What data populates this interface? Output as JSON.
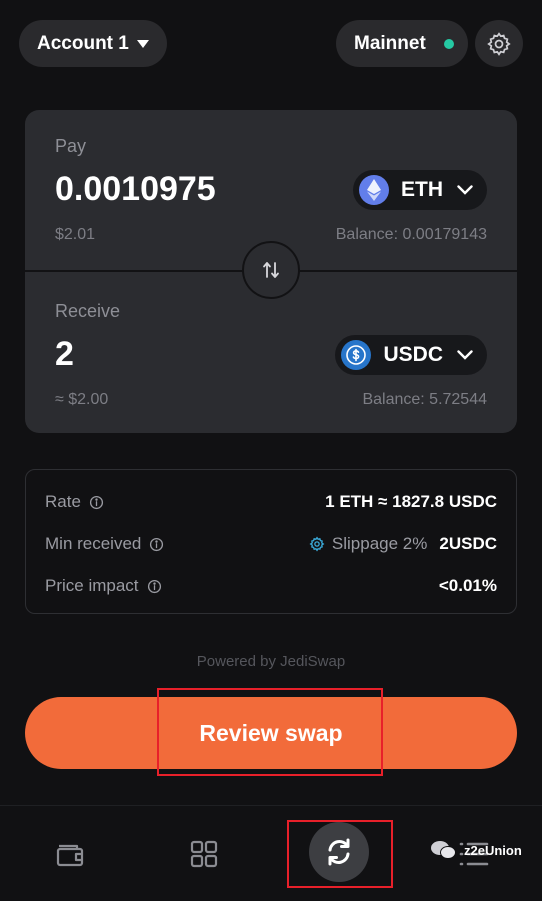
{
  "header": {
    "account_label": "Account 1",
    "network_label": "Mainnet",
    "network_status_color": "#25c9a3"
  },
  "swap": {
    "pay": {
      "label": "Pay",
      "amount": "0.0010975",
      "fiat": "$2.01",
      "token": "ETH",
      "balance": "Balance: 0.00179143"
    },
    "receive": {
      "label": "Receive",
      "amount": "2",
      "fiat": "≈ $2.00",
      "token": "USDC",
      "balance": "Balance: 5.72544"
    }
  },
  "details": {
    "rate_label": "Rate",
    "rate_value": "1 ETH ≈ 1827.8 USDC",
    "min_received_label": "Min received",
    "slippage_label": "Slippage 2%",
    "min_received_value": "2USDC",
    "price_impact_label": "Price impact",
    "price_impact_value": "<0.01%"
  },
  "powered_by": "Powered by JediSwap",
  "review_button_label": "Review swap",
  "colors": {
    "accent": "#f26b3a",
    "highlight": "#e8202a",
    "eth": "#627eea",
    "usdc": "#2775ca"
  },
  "nav": {
    "items": [
      "wallet-icon",
      "apps-grid-icon",
      "swap-icon",
      "activity-list-icon"
    ],
    "active": "swap-icon"
  },
  "watermark": "z2eUnion"
}
